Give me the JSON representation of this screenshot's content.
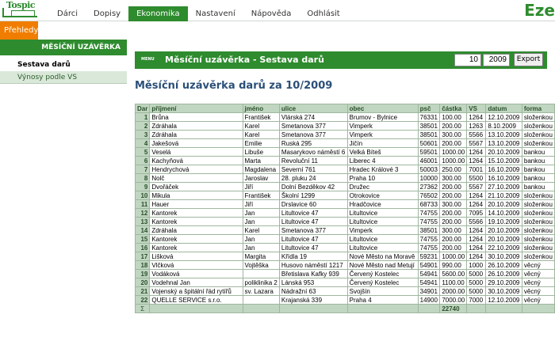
{
  "app": {
    "brand": "Eze"
  },
  "logo": {
    "text": "Tospic"
  },
  "topnav": {
    "tabs": [
      {
        "label": "Dárci"
      },
      {
        "label": "Dopisy"
      },
      {
        "label": "Ekonomika",
        "active": true
      },
      {
        "label": "Nastavení"
      },
      {
        "label": "Nápověda"
      },
      {
        "label": "Odhlásit"
      }
    ]
  },
  "subbar": {
    "pill_label": "Přehledy"
  },
  "sidebar": {
    "head": "MĚSÍČNÍ UZÁVĚRKA",
    "items": [
      {
        "label": "Sestava darů",
        "active": true
      },
      {
        "label": "Výnosy podle VS"
      }
    ]
  },
  "toolbar": {
    "menu_label": "MENU",
    "title": "Měsíční uzávěrka - Sestava darů",
    "month_value": "10",
    "year_value": "2009",
    "export_label": "Export"
  },
  "main": {
    "heading": "Měsíční uzávěrka darů za 10/2009"
  },
  "colors": {
    "accent": "#2e8b2e",
    "orange": "#f07d00",
    "heading": "#2b4f78",
    "header_bg": "#c0d6c0"
  },
  "table": {
    "headers": [
      "Dar",
      "příjmení",
      "jméno",
      "ulice",
      "obec",
      "psč",
      "částka",
      "VS",
      "datum",
      "forma"
    ],
    "rows": [
      [
        "1",
        "Brůna",
        "František",
        "Vlárská 274",
        "Brumov - Bylnice",
        "76331",
        "100.00",
        "1264",
        "12.10.2009",
        "složenkou"
      ],
      [
        "2",
        "Zdráhala",
        "Karel",
        "Smetanova 377",
        "Vimperk",
        "38501",
        "200.00",
        "1263",
        "8.10.2009",
        "složenkou"
      ],
      [
        "3",
        "Zdráhala",
        "Karel",
        "Smetanova 377",
        "Vimperk",
        "38501",
        "300.00",
        "5566",
        "13.10.2009",
        "složenkou"
      ],
      [
        "4",
        "Jakešová",
        "Emilie",
        "Ruská 295",
        "Jičín",
        "50601",
        "200.00",
        "5567",
        "13.10.2009",
        "složenkou"
      ],
      [
        "5",
        "Veselá",
        "Libuše",
        "Masarykovo náměstí 6",
        "Velká Bíteš",
        "59501",
        "1000.00",
        "1264",
        "20.10.2009",
        "bankou"
      ],
      [
        "6",
        "Kachyňová",
        "Marta",
        "Revoluční 11",
        "Liberec 4",
        "46001",
        "1000.00",
        "1264",
        "15.10.2009",
        "bankou"
      ],
      [
        "7",
        "Hendrychová",
        "Magdalena",
        "Severní 761",
        "Hradec Králové 3",
        "50003",
        "250.00",
        "7001",
        "16.10.2009",
        "bankou"
      ],
      [
        "8",
        "Nolč",
        "Jaroslav",
        "28. pluku 24",
        "Praha 10",
        "10000",
        "300.00",
        "5500",
        "16.10.2009",
        "bankou"
      ],
      [
        "9",
        "Dvořáček",
        "Jiří",
        "Dolní Bezděkov 42",
        "Družec",
        "27362",
        "200.00",
        "5567",
        "27.10.2009",
        "bankou"
      ],
      [
        "10",
        "Mikula",
        "František",
        "Školní 1299",
        "Otrokovice",
        "76502",
        "200.00",
        "1264",
        "21.10.2009",
        "složenkou"
      ],
      [
        "11",
        "Hauer",
        "Jiří",
        "Drslavice 60",
        "Hradčovice",
        "68733",
        "300.00",
        "1264",
        "20.10.2009",
        "složenkou"
      ],
      [
        "12",
        "Kantorek",
        "Jan",
        "Litultovice 47",
        "Litultovice",
        "74755",
        "200.00",
        "7095",
        "14.10.2009",
        "složenkou"
      ],
      [
        "13",
        "Kantorek",
        "Jan",
        "Litultovice 47",
        "Litultovice",
        "74755",
        "200.00",
        "5566",
        "19.10.2009",
        "složenkou"
      ],
      [
        "14",
        "Zdráhala",
        "Karel",
        "Smetanova 377",
        "Vimperk",
        "38501",
        "300.00",
        "1264",
        "20.10.2009",
        "složenkou"
      ],
      [
        "15",
        "Kantorek",
        "Jan",
        "Litultovice 47",
        "Litultovice",
        "74755",
        "200.00",
        "1264",
        "20.10.2009",
        "složenkou"
      ],
      [
        "16",
        "Kantorek",
        "Jan",
        "Litultovice 47",
        "Litultovice",
        "74755",
        "200.00",
        "1264",
        "22.10.2009",
        "složenkou"
      ],
      [
        "17",
        "Lišková",
        "Margita",
        "Křídla 19",
        "Nové Město na Moravě",
        "59231",
        "1000.00",
        "1264",
        "30.10.2009",
        "složenkou"
      ],
      [
        "18",
        "Vlčková",
        "Vojtěška",
        "Husovo náměstí 1217",
        "Nové Město nad Metují",
        "54901",
        "990.00",
        "1000",
        "26.10.2009",
        "věcný"
      ],
      [
        "19",
        "Vodáková",
        "",
        "Břetislava Kafky 939",
        "Červený Kostelec",
        "54941",
        "5600.00",
        "5000",
        "26.10.2009",
        "věcný"
      ],
      [
        "20",
        "Vodehnal Jan",
        "poliklinika 2",
        "Lánská 953",
        "Červený Kostelec",
        "54941",
        "1100.00",
        "5000",
        "29.10.2009",
        "věcný"
      ],
      [
        "21",
        "Vojenský a špitální řád rytířů",
        "sv. Lazara",
        "Nádražní 63",
        "Svojšín",
        "34901",
        "2000.00",
        "5000",
        "30.10.2009",
        "věcný"
      ],
      [
        "22",
        "QUELLE SERVICE s.r.o.",
        "",
        "Krajanská 339",
        "Praha 4",
        "14900",
        "7000.00",
        "7000",
        "12.10.2009",
        "věcný"
      ]
    ],
    "sum_symbol": "Σ",
    "sum_value": "22740"
  }
}
